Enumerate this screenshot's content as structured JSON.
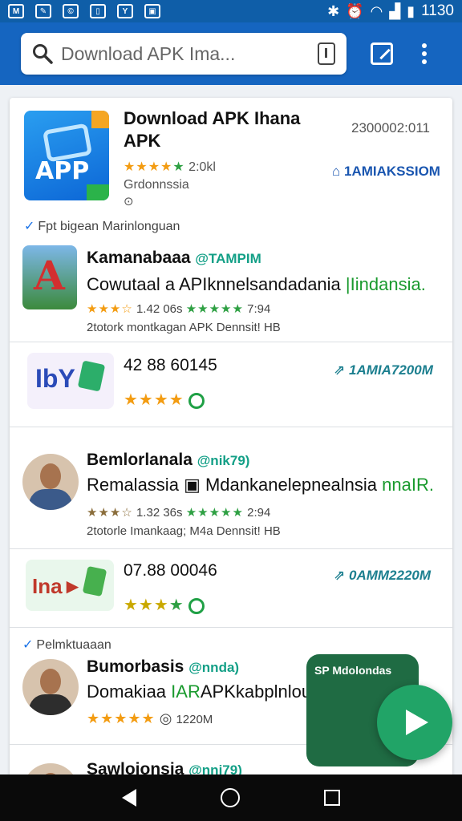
{
  "status_bar": {
    "app_icons": [
      "M",
      "✎",
      "©",
      "▯",
      "Y",
      "▣"
    ],
    "time": "1130"
  },
  "search": {
    "placeholder": "Download APK Ima..."
  },
  "featured": {
    "title_line1": "Download APK Ihana",
    "title_line2": "APK",
    "rating_text": "2:0kl",
    "developer": "Grdonnssia",
    "date": "2300002:011",
    "link": "1AMIAKSSIOM",
    "section_label": "Fpt bigean  Marinlonguan"
  },
  "items": [
    {
      "name": "Kamanabaaa",
      "tag": "@TAMPIM",
      "desc_main": "Cowutaal a APIknnelsandadania",
      "desc_green": "|Iindansia.",
      "stats": "1.42   06s",
      "extra": "7:94",
      "foot": "2totork montkagan APK Dennsit! HB"
    },
    {
      "number": "42 88 60145",
      "link": "1AMIA7200M"
    },
    {
      "name": "Bemlorlanala",
      "tag": "@nik79)",
      "desc_main": "Remalassia",
      "desc_mid": "Mdankanelepnealnsia",
      "desc_green": "nnaIR.",
      "stats": "1.32   36s",
      "extra": "2:94",
      "foot": "2totorle Imankaag; M4a Dennsit! HB"
    },
    {
      "number": "07.88 00046",
      "link": "0AMM2220M"
    },
    {
      "section_label": "Pelmktuaaan",
      "name": "Bumorbasis",
      "tag": "@nnda)",
      "desc_main": "Domakiaa",
      "desc_green": "IAR",
      "desc_tail": "APKkabplnlouik",
      "stats": "1220M"
    },
    {
      "name": "Sawloionsia",
      "tag": "@nni79)"
    }
  ],
  "promo": {
    "label": "SP Mdolondas"
  }
}
